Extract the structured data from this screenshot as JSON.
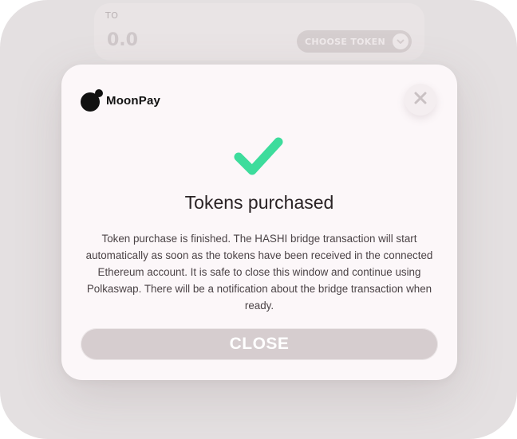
{
  "background": {
    "to_label": "TO",
    "amount": "0.0",
    "choose_token_label": "CHOOSE TOKEN"
  },
  "dialog": {
    "brand": "MoonPay",
    "title": "Tokens purchased",
    "message": "Token purchase is finished. The HASHI bridge transaction will start automatically as soon as the tokens have been received in the connected Ethereum account. It is safe to close this window and continue using Polkaswap. There will be a notification about the bridge transaction when ready.",
    "close_button_label": "CLOSE"
  },
  "colors": {
    "success_check": "#3ddc9c",
    "button_bg": "#d6cdcf",
    "dialog_bg": "#fcf7f9"
  },
  "icons": {
    "close": "close-x-icon",
    "status": "checkmark-icon",
    "chevron": "chevron-down-icon"
  }
}
